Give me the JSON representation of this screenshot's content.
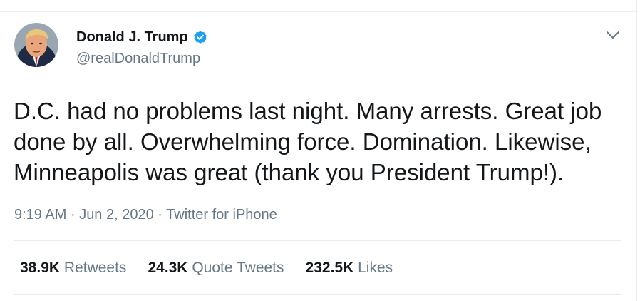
{
  "tweet": {
    "author_name": "Donald J. Trump",
    "author_handle": "@realDonaldTrump",
    "text": "D.C. had no problems last night. Many arrests. Great job\ndone by all. Overwhelming force. Domination. Likewise,\nMinneapolis was great (thank you President Trump!).",
    "time": "9:19 AM",
    "date": "Jun 2, 2020",
    "source": "Twitter for iPhone",
    "separator": "·"
  },
  "stats": {
    "retweets_count": "38.9K",
    "retweets_label": "Retweets",
    "quote_count": "24.3K",
    "quote_label": "Quote Tweets",
    "likes_count": "232.5K",
    "likes_label": "Likes"
  },
  "colors": {
    "verified_badge": "#1da1f2",
    "secondary_text": "#657786",
    "primary_text": "#14171a",
    "divider": "#e6ecf0"
  },
  "icons": {
    "verified": "verified-badge-icon",
    "more": "chevron-down-icon"
  }
}
